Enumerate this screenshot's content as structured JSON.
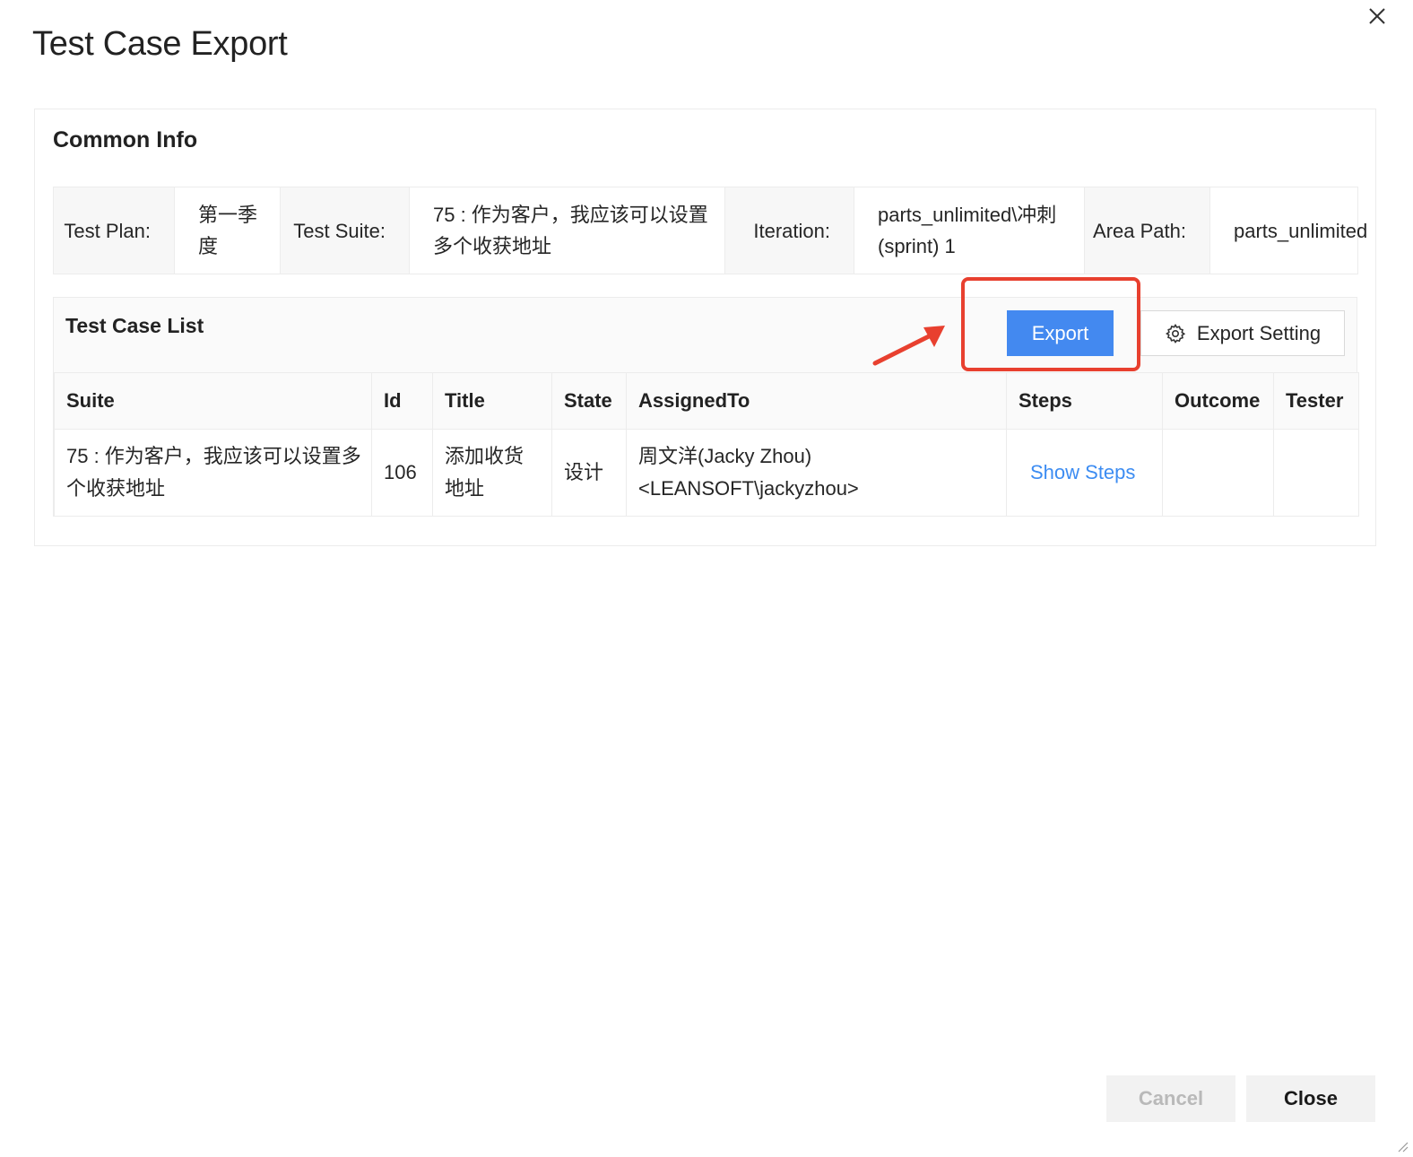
{
  "dialog": {
    "title": "Test Case Export",
    "close_icon": "close-icon"
  },
  "common_info": {
    "title": "Common Info",
    "test_plan_label": "Test Plan:",
    "test_plan_value": "第一季度",
    "test_suite_label": "Test Suite:",
    "test_suite_value": "75 : 作为客户，我应该可以设置多个收获地址",
    "iteration_label": "Iteration:",
    "iteration_value": "parts_unlimited\\冲刺(sprint) 1",
    "area_path_label": "Area Path:",
    "area_path_value": "parts_unlimited"
  },
  "test_case_list": {
    "title": "Test Case List",
    "export_label": "Export",
    "export_setting_label": "Export Setting",
    "setting_icon": "gear-icon",
    "columns": [
      "Suite",
      "Id",
      "Title",
      "State",
      "AssignedTo",
      "Steps",
      "Outcome",
      "Tester"
    ],
    "rows": [
      {
        "suite": "75 : 作为客户，我应该可以设置多个收获地址",
        "id": "106",
        "title": "添加收货地址",
        "state": "设计",
        "assigned_to": "周文洋(Jacky Zhou) <LEANSOFT\\jackyzhou>",
        "steps": "Show Steps",
        "outcome": "",
        "tester": ""
      }
    ]
  },
  "annotation": {
    "highlight_color": "#e8402f",
    "arrow_color": "#e8402f"
  },
  "footer": {
    "cancel_label": "Cancel",
    "close_label": "Close"
  },
  "colors": {
    "primary": "#4389f0",
    "link": "#3c8cf2"
  }
}
